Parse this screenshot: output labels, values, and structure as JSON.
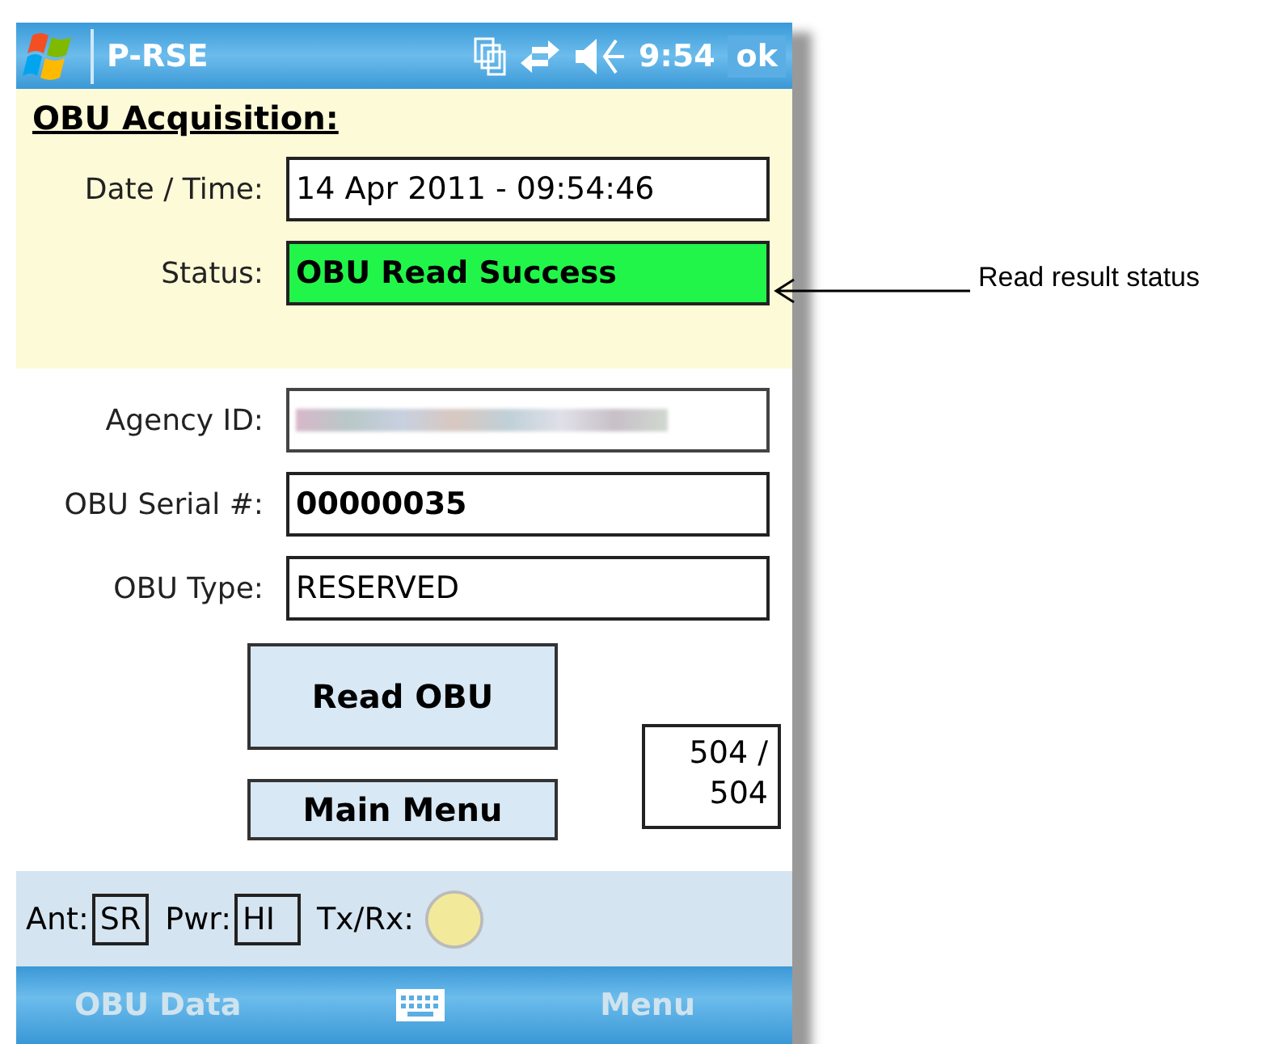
{
  "title_bar": {
    "app": "P-RSE",
    "time": "9:54",
    "ok": "ok"
  },
  "acquisition": {
    "heading": "OBU Acquisition:",
    "fields": [
      {
        "label": "Date / Time:",
        "value": "14 Apr 2011 - 09:54:46",
        "kind": "text"
      },
      {
        "label": "Status:",
        "value": "OBU Read Success",
        "kind": "success"
      }
    ]
  },
  "details": [
    {
      "label": "Agency ID:",
      "kind": "redacted"
    },
    {
      "label": "OBU Serial #:",
      "value": "00000035",
      "kind": "bold"
    },
    {
      "label": "OBU Type:",
      "value": "RESERVED",
      "kind": "text"
    }
  ],
  "buttons": {
    "read": "Read OBU",
    "main": "Main Menu"
  },
  "counter": {
    "line1": "504 /",
    "line2": "504"
  },
  "status_strip": {
    "ant_label": "Ant:",
    "ant": "SR",
    "pwr_label": "Pwr:",
    "pwr": "HI",
    "txrx_label": "Tx/Rx:"
  },
  "softkeys": {
    "left": "OBU Data",
    "right": "Menu"
  },
  "annotation": "Read result status"
}
